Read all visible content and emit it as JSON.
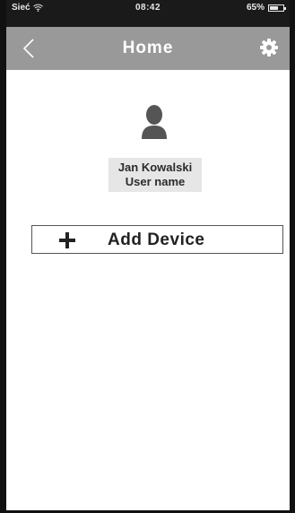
{
  "status_bar": {
    "carrier": "Sieć",
    "time": "08:42",
    "battery": "65%",
    "battery_level": 0.65,
    "wifi_icon": "wifi-icon",
    "battery_icon": "battery-icon"
  },
  "nav": {
    "title": "Home",
    "back_icon": "chevron-left-icon",
    "settings_icon": "gear-icon"
  },
  "user": {
    "avatar_icon": "user-icon",
    "name": "Jan Kowalski",
    "subtitle": "User name"
  },
  "add_device": {
    "label": "Add Device",
    "icon": "plus-icon"
  },
  "colors": {
    "status_bar_bg": "#1a1a1a",
    "nav_bg": "#999999",
    "user_card_bg": "#e6e6e6",
    "frame": "#111111"
  }
}
